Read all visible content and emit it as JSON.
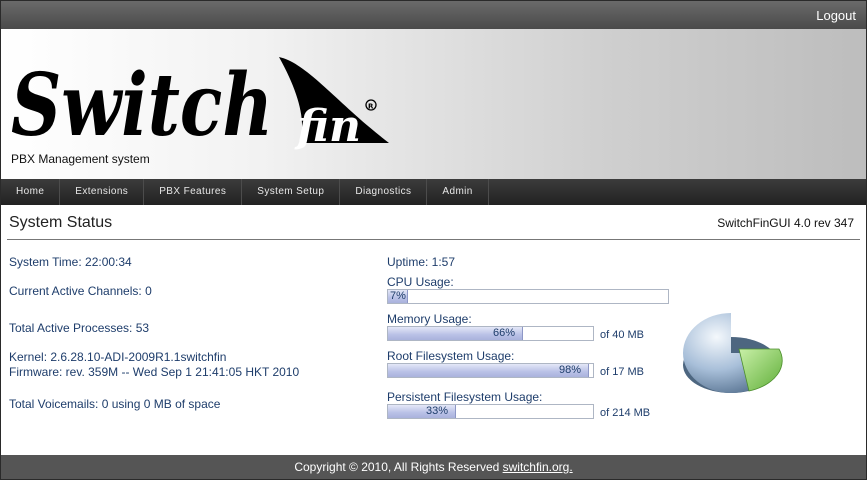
{
  "topbar": {
    "logout_label": "Logout"
  },
  "header": {
    "logo_text": "Switch",
    "logo_fin_text": "fin",
    "tagline": "PBX Management system"
  },
  "nav": [
    {
      "label": "Home"
    },
    {
      "label": "Extensions"
    },
    {
      "label": "PBX Features"
    },
    {
      "label": "System Setup"
    },
    {
      "label": "Diagnostics"
    },
    {
      "label": "Admin"
    }
  ],
  "status": {
    "title": "System Status",
    "version": "SwitchFinGUI 4.0 rev 347",
    "system_time": "System Time: 22:00:34",
    "active_channels": "Current Active Channels: 0",
    "active_processes": "Total Active Processes: 53",
    "kernel": "Kernel: 2.6.28.10-ADI-2009R1.1switchfin",
    "firmware": "Firmware: rev. 359M -- Wed Sep 1 21:41:05 HKT 2010",
    "voicemails": "Total Voicemails: 0 using 0 MB of space",
    "uptime": "Uptime: 1:57"
  },
  "usage": {
    "cpu": {
      "label": "CPU Usage:",
      "percent": 7,
      "text": "7%",
      "of": ""
    },
    "memory": {
      "label": "Memory Usage:",
      "percent": 66,
      "text": "66%",
      "of": "of 40 MB"
    },
    "rootfs": {
      "label": "Root Filesystem Usage:",
      "percent": 98,
      "text": "98%",
      "of": "of 17 MB"
    },
    "persistfs": {
      "label": "Persistent Filesystem Usage:",
      "percent": 33,
      "text": "33%",
      "of": "of 214 MB"
    }
  },
  "colors": {
    "pie_main": "#a8bfd9",
    "pie_slice": "#8fd46a",
    "text_blue": "#1e3d6b"
  },
  "footer": {
    "copyright": "Copyright © 2010, All Rights Reserved ",
    "link": "switchfin.org."
  }
}
